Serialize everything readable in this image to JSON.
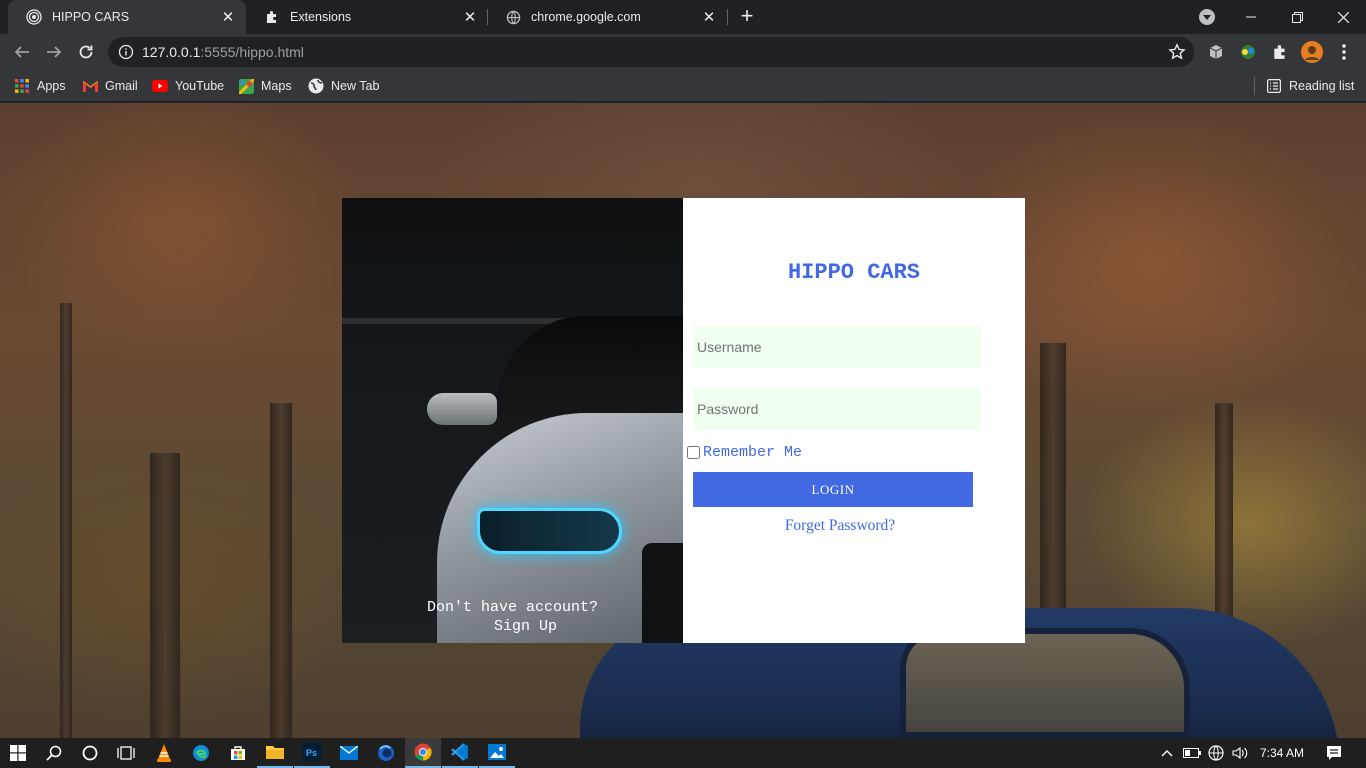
{
  "browser": {
    "tabs": [
      {
        "title": "HIPPO CARS",
        "active": true
      },
      {
        "title": "Extensions",
        "active": false
      },
      {
        "title": "chrome.google.com",
        "active": false
      }
    ],
    "url_host": "127.0.0.1",
    "url_rest": ":5555/hippo.html",
    "bookmarks": [
      "Apps",
      "Gmail",
      "YouTube",
      "Maps",
      "New Tab"
    ],
    "reading_list": "Reading list"
  },
  "page": {
    "brand": "HIPPO CARS",
    "username_placeholder": "Username",
    "password_placeholder": "Password",
    "remember_label": "Remember Me",
    "login_label": "LOGIN",
    "forget_label": "Forget Password?",
    "signup_prompt": "Don't have account?",
    "signup_link": "Sign Up",
    "accent_color": "#4169e1",
    "field_bg": "#f0fff0"
  },
  "taskbar": {
    "apps": [
      "windows-start",
      "search",
      "cortana",
      "task-view",
      "vlc",
      "edge",
      "store",
      "file-explorer",
      "photoshop",
      "mail",
      "firefox-dev",
      "chrome",
      "vscode",
      "photos"
    ],
    "time": "7:34 AM"
  }
}
